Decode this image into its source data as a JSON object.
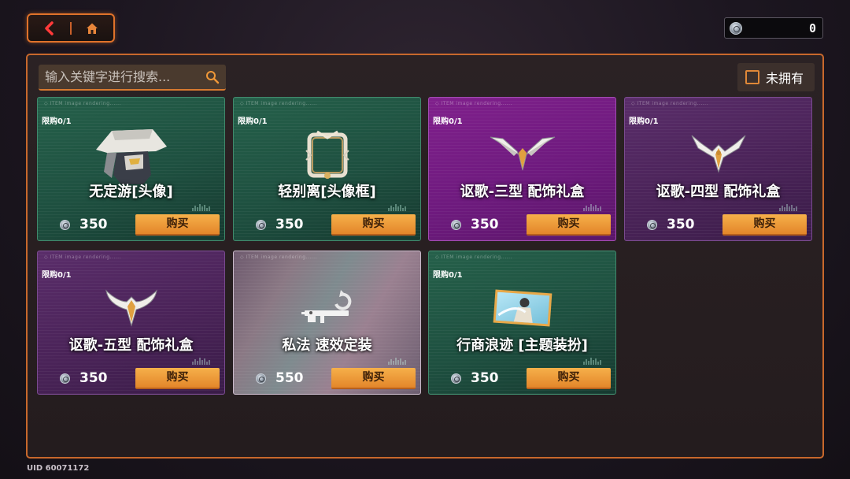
{
  "nav": {
    "back_icon": "chevron-left-icon",
    "home_icon": "home-icon"
  },
  "currency": {
    "value": "0",
    "icon": "silver-coin-icon"
  },
  "search": {
    "placeholder": "输入关键字进行搜索..."
  },
  "filter": {
    "label": "未拥有",
    "checked": false
  },
  "items": [
    {
      "limit": "限购0/1",
      "name": "无定游[头像]",
      "price": "350",
      "buy": "购买",
      "theme": "green",
      "art": "avatar-portrait-icon"
    },
    {
      "limit": "限购0/1",
      "name": "轻别离[头像框]",
      "price": "350",
      "buy": "购买",
      "theme": "green",
      "art": "avatar-frame-icon"
    },
    {
      "limit": "限购0/1",
      "name": "讴歌-三型 配饰礼盒",
      "price": "350",
      "buy": "购买",
      "theme": "bright",
      "art": "wing-accessory-icon"
    },
    {
      "limit": "限购0/1",
      "name": "讴歌-四型 配饰礼盒",
      "price": "350",
      "buy": "购买",
      "theme": "purple",
      "art": "wing-accessory-icon"
    },
    {
      "limit": "限购0/1",
      "name": "讴歌-五型 配饰礼盒",
      "price": "350",
      "buy": "购买",
      "theme": "purple",
      "art": "wing-accessory-icon"
    },
    {
      "limit": "",
      "name": "私法 速效定装",
      "price": "550",
      "buy": "购买",
      "theme": "holo",
      "art": "rifle-reload-icon"
    },
    {
      "limit": "限购0/1",
      "name": "行商浪迹 [主题装扮]",
      "price": "350",
      "buy": "购买",
      "theme": "green",
      "art": "theme-card-icon"
    }
  ],
  "uid": "UID 60071172",
  "colors": {
    "accent": "#e0722a",
    "buy_button": "#f0a040"
  }
}
